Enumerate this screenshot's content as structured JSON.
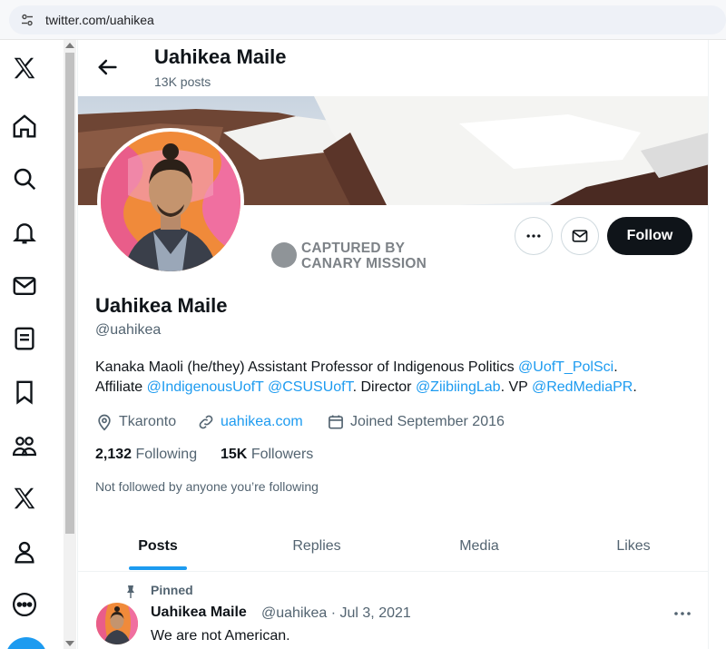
{
  "browser": {
    "url": "twitter.com/uahikea"
  },
  "nav": {
    "items": [
      "x-logo",
      "home",
      "explore",
      "notifications",
      "messages",
      "lists",
      "bookmarks",
      "communities",
      "premium",
      "profile",
      "more"
    ]
  },
  "header": {
    "name": "Uahikea Maile",
    "posts": "13K posts"
  },
  "watermark": {
    "line1": "CAPTURED BY",
    "line2": "CANARY MISSION"
  },
  "actions": {
    "follow_label": "Follow"
  },
  "profile": {
    "display_name": "Uahikea Maile",
    "handle": "@uahikea",
    "bio": {
      "line1_text": "Kanaka Maoli (he/they) Assistant Professor of Indigenous Politics ",
      "line1_mention": "@UofT_PolSci",
      "line1_end": ".",
      "line2_a": "Affiliate ",
      "line2_m1": "@IndigenousUofT",
      "line2_sp": " ",
      "line2_m2": "@CSUSUofT",
      "line2_b": ". Director ",
      "line2_m3": "@ZiibiingLab",
      "line2_c": ". VP ",
      "line2_m4": "@RedMediaPR",
      "line2_end": "."
    },
    "location": "Tkaronto",
    "website": "uahikea.com",
    "joined": "Joined September 2016",
    "following_count": "2,132",
    "following_label": "Following",
    "followers_count": "15K",
    "followers_label": "Followers",
    "not_followed": "Not followed by anyone you’re following"
  },
  "tabs": [
    "Posts",
    "Replies",
    "Media",
    "Likes"
  ],
  "pinned_tweet": {
    "pinned_label": "Pinned",
    "author": "Uahikea Maile",
    "meta": "@uahikea · Jul 3, 2021",
    "text": "We are not American."
  },
  "colors": {
    "accent": "#1d9bf0",
    "text": "#0f1419",
    "muted": "#536471",
    "follow_bg": "#0f1419"
  }
}
